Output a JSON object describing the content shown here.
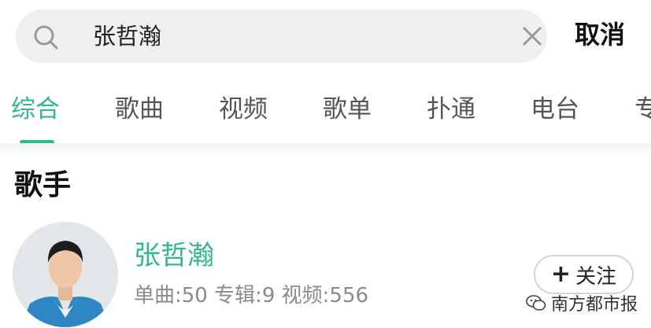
{
  "search": {
    "value": "张哲瀚",
    "cancel_label": "取消"
  },
  "tabs": [
    {
      "label": "综合",
      "active": true
    },
    {
      "label": "歌曲"
    },
    {
      "label": "视频"
    },
    {
      "label": "歌单"
    },
    {
      "label": "扑通"
    },
    {
      "label": "电台"
    },
    {
      "label": "专"
    }
  ],
  "section": {
    "title": "歌手"
  },
  "artist": {
    "name": "张哲瀚",
    "stats": "单曲:50  专辑:9  视频:556",
    "follow_label": "关注"
  },
  "watermark": {
    "text": "南方都市报"
  },
  "colors": {
    "accent": "#31b98a",
    "search_bg": "#eeeff1"
  }
}
